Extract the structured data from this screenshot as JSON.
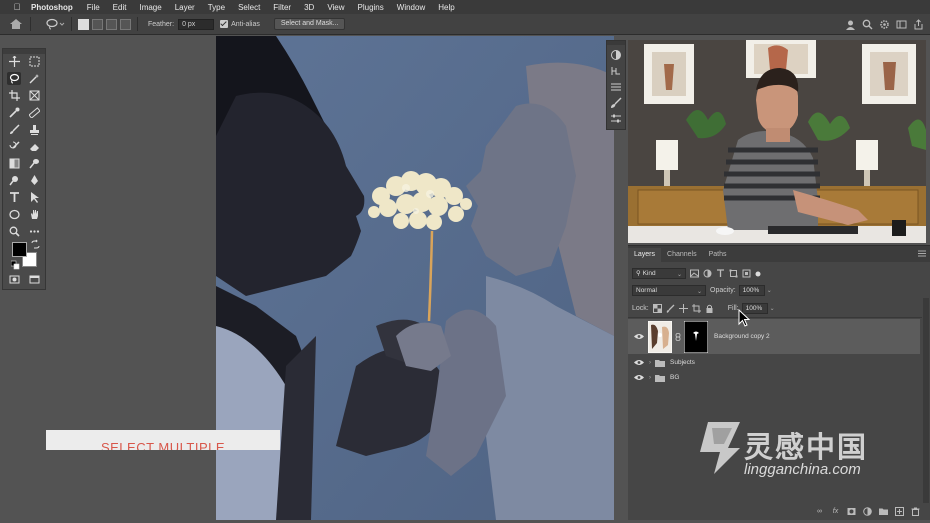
{
  "menubar": {
    "app_name": "Photoshop",
    "items": [
      "File",
      "Edit",
      "Image",
      "Layer",
      "Type",
      "Select",
      "Filter",
      "3D",
      "View",
      "Plugins",
      "Window",
      "Help"
    ]
  },
  "options_bar": {
    "feather_label": "Feather:",
    "feather_value": "0 px",
    "anti_alias_label": "Anti-alias",
    "select_mask_label": "Select and Mask..."
  },
  "caption": {
    "text": "SELECT MULTIPLE"
  },
  "layers_panel": {
    "tabs": [
      "Layers",
      "Channels",
      "Paths"
    ],
    "filter_kind": "Kind",
    "blend_mode": "Normal",
    "opacity_label": "Opacity:",
    "opacity_value": "100%",
    "lock_label": "Lock:",
    "fill_label": "Fill:",
    "fill_value": "100%",
    "layers": [
      {
        "name": "Background copy 2",
        "type": "layer",
        "selected": true
      },
      {
        "name": "Subjects",
        "type": "group",
        "selected": false
      },
      {
        "name": "BG",
        "type": "group",
        "selected": false
      }
    ]
  },
  "watermark": {
    "chinese": "灵感中国",
    "latin": "lingganchina.com"
  },
  "colors": {
    "ui_dark": "#3a3a3a",
    "ui_panel": "#464646",
    "canvas_bg": "#5a6f8e",
    "caption_text": "#d8564a"
  }
}
